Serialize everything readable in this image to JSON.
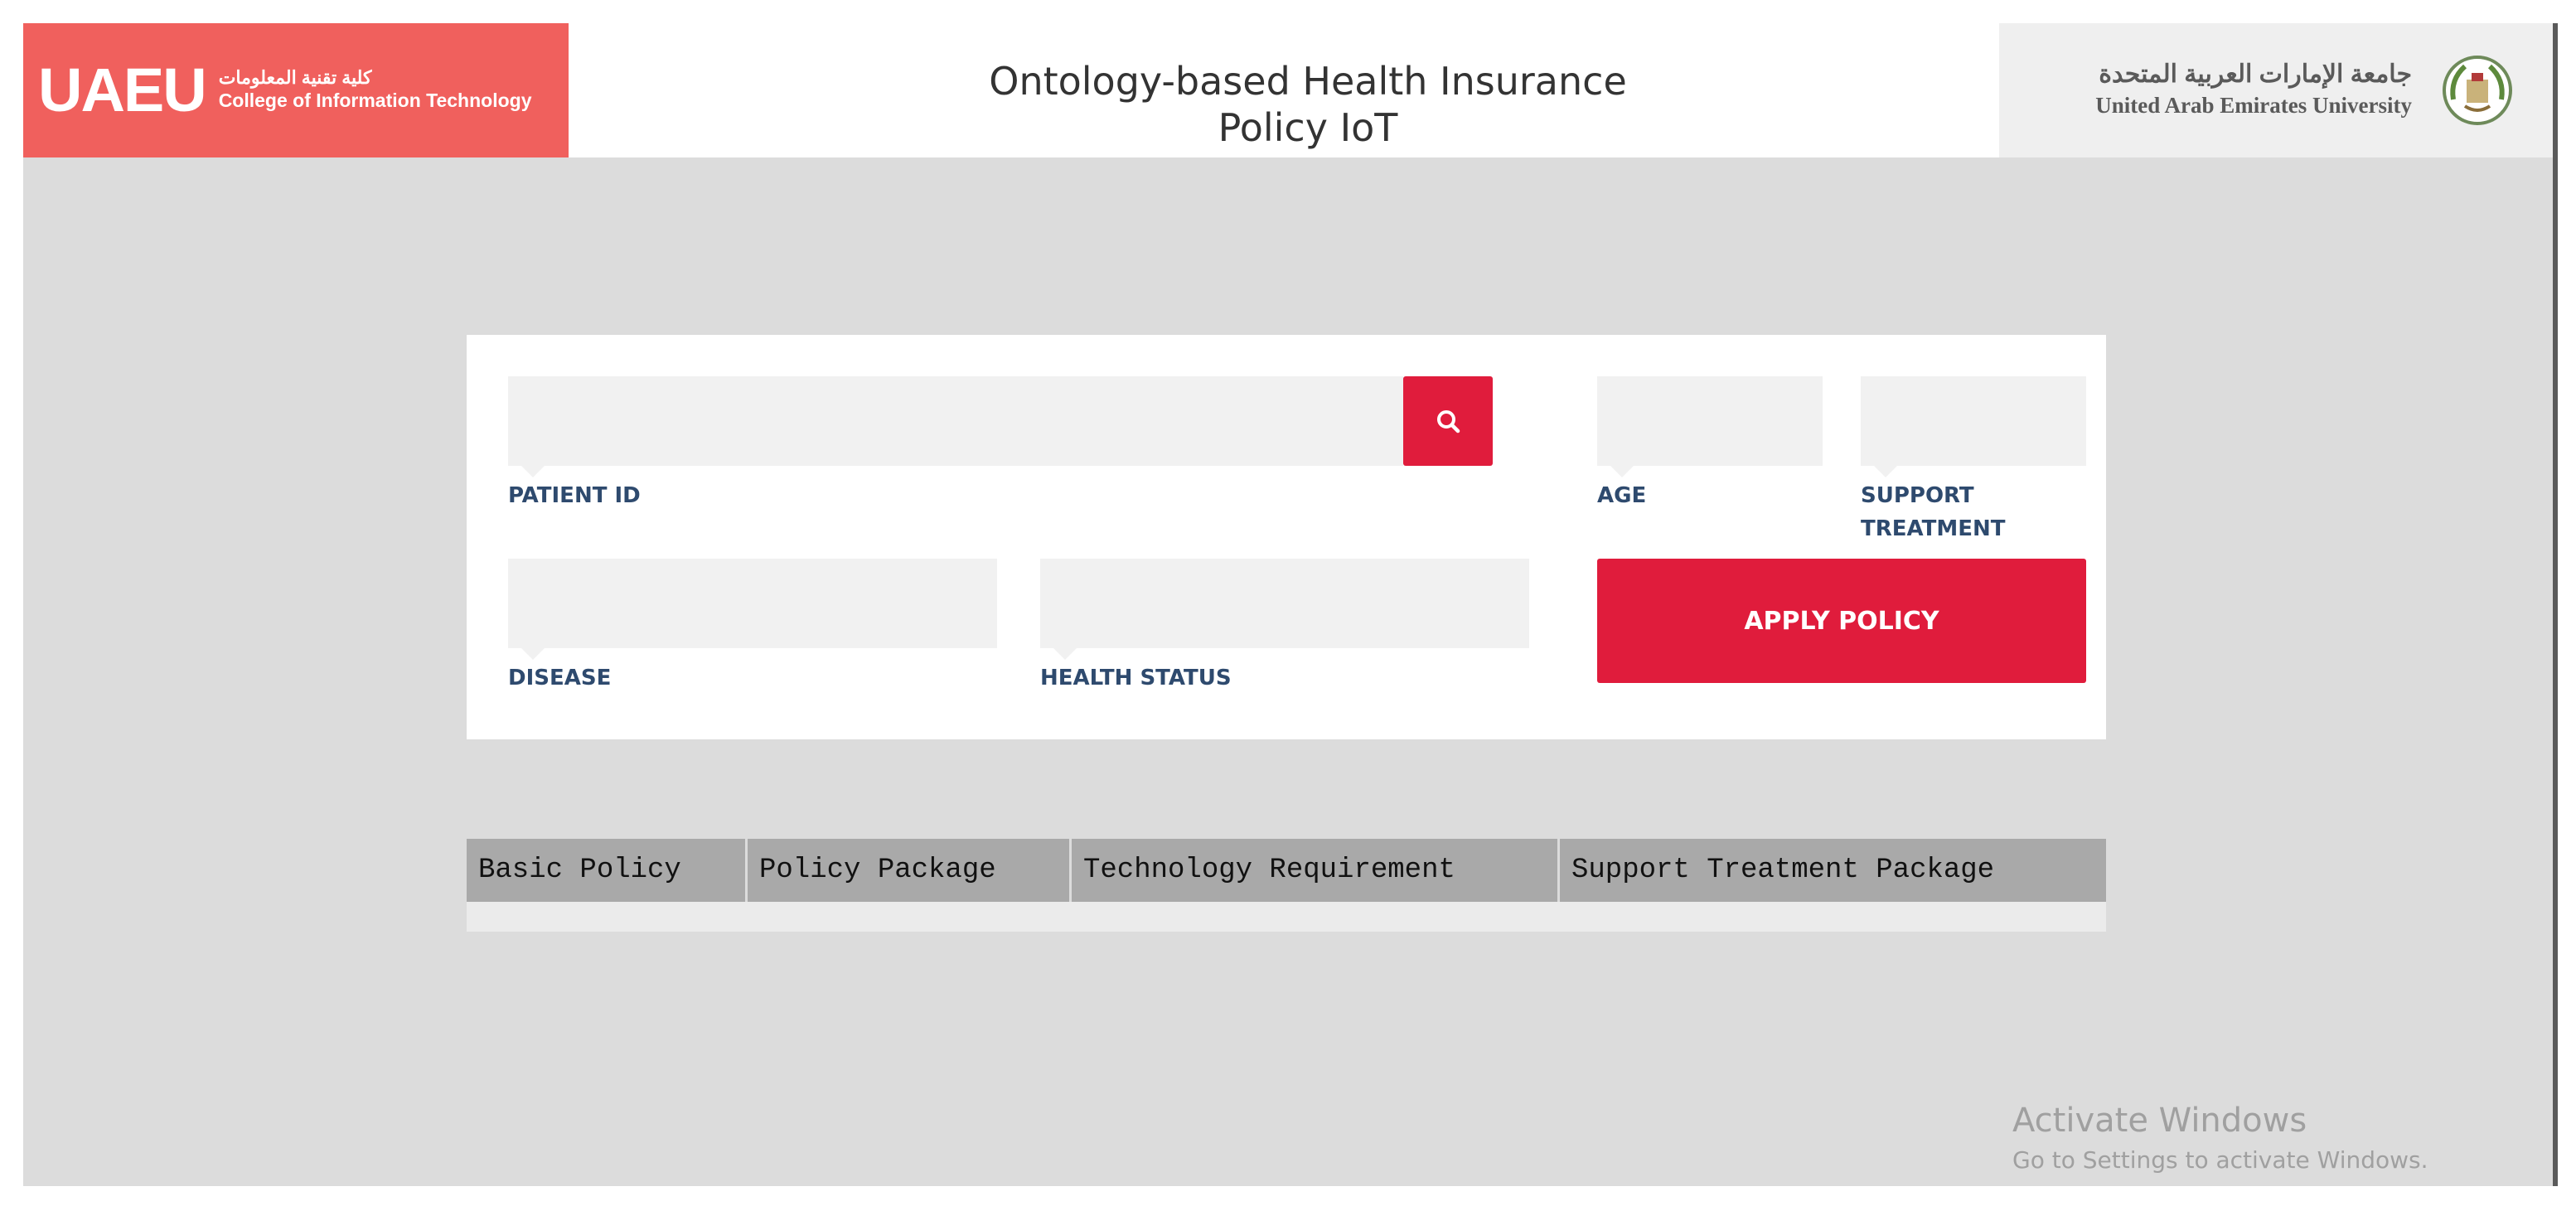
{
  "header": {
    "title_line1": "Ontology-based Health Insurance",
    "title_line2": "Policy IoT",
    "college_logo": {
      "mark": "UAEU",
      "arabic_name": "كلية تقنية المعلومات",
      "english_name": "College of Information Technology",
      "background_color": "#f0605d"
    },
    "university_logo": {
      "arabic_name": "جامعة الإمارات العربية المتحدة",
      "english_name": "United Arab Emirates University",
      "emblem_icon": "university-emblem-icon"
    }
  },
  "form": {
    "patient_id": {
      "label": "PATIENT ID",
      "value": "",
      "placeholder": ""
    },
    "search_button": {
      "icon": "search-icon"
    },
    "age": {
      "label": "AGE",
      "value": "",
      "placeholder": ""
    },
    "support_treatment": {
      "label_line1": "SUPPORT",
      "label_line2": "TREATMENT",
      "value": "",
      "placeholder": ""
    },
    "disease": {
      "label": "DISEASE",
      "value": "",
      "placeholder": ""
    },
    "health_status": {
      "label": "HEALTH STATUS",
      "value": "",
      "placeholder": ""
    },
    "apply_button": {
      "label": "APPLY POLICY"
    }
  },
  "results_table": {
    "columns": [
      "Basic Policy",
      "Policy Package",
      "Technology Requirement",
      "Support Treatment Package"
    ]
  },
  "watermark": {
    "line1": "Activate Windows",
    "line2": "Go to Settings to activate Windows."
  },
  "colors": {
    "accent_red": "#e01c3c",
    "label_blue": "#2e4a6e",
    "page_background": "#dcdcdc",
    "table_header": "#a9a9a9"
  }
}
